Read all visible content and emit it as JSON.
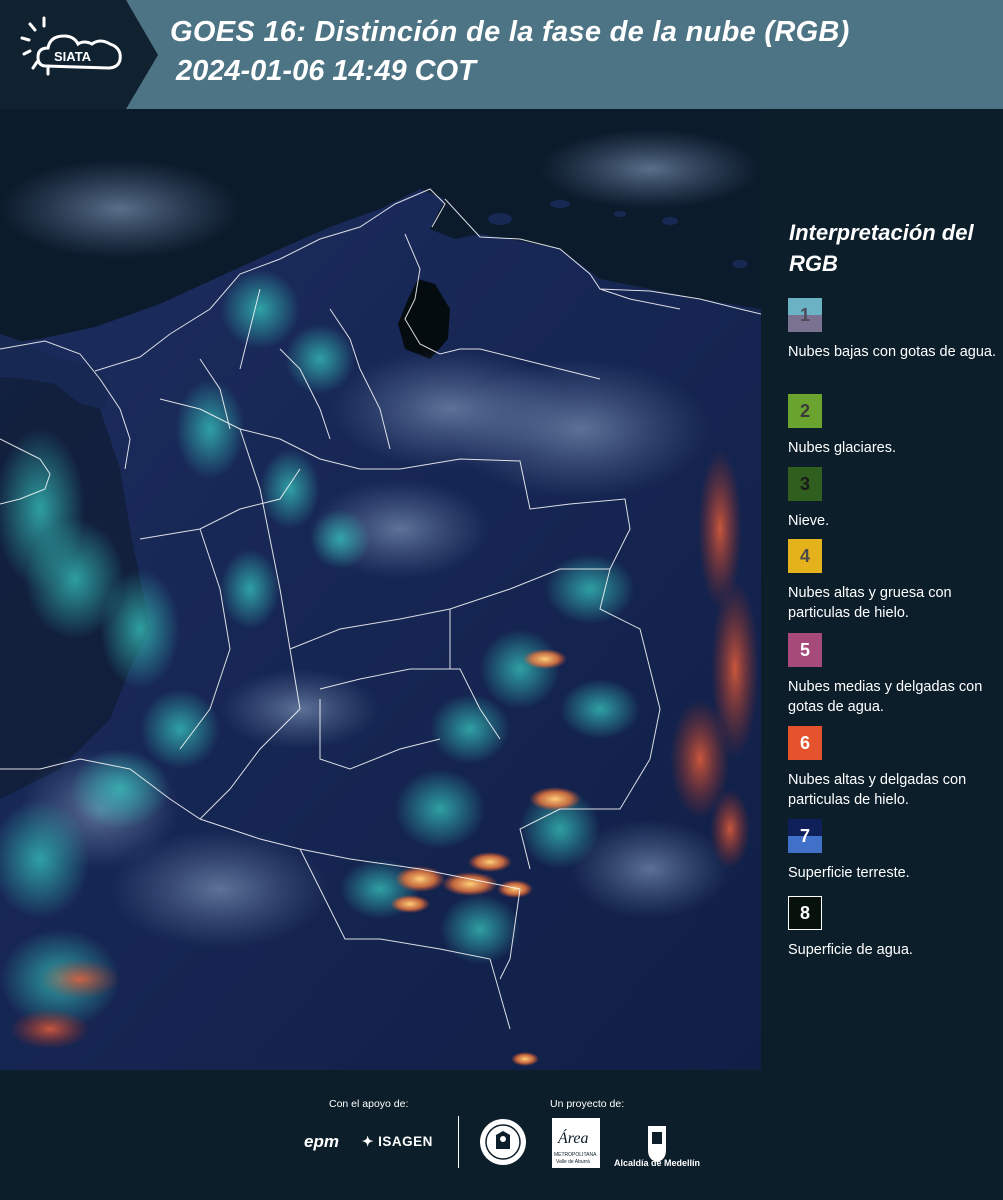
{
  "header": {
    "logo_text": "SIATA",
    "title": "GOES 16: Distinción de la fase de la nube (RGB)",
    "timestamp": "2024-01-06 14:49 COT"
  },
  "legend": {
    "title": "Interpretación del RGB",
    "items": [
      {
        "number": "1",
        "label": "Nubes bajas con gotas de agua.",
        "color_top": "#6bb3c4",
        "color_bottom": "#7a7290",
        "number_color": "#4a4a5a"
      },
      {
        "number": "2",
        "label": "Nubes glaciares.",
        "color_top": "#6aa32d",
        "color_bottom": "#6aa32d",
        "number_color": "#3a3a3a"
      },
      {
        "number": "3",
        "label": "Nieve.",
        "color_top": "#2f5e1f",
        "color_bottom": "#2f5e1f",
        "number_color": "#1a1a1a"
      },
      {
        "number": "4",
        "label": "Nubes altas y gruesa con particulas de hielo.",
        "color_top": "#e6b21c",
        "color_bottom": "#e6b21c",
        "number_color": "#4a4a4a"
      },
      {
        "number": "5",
        "label": "Nubes medias y delgadas con gotas de agua.",
        "color_top": "#a64a7a",
        "color_bottom": "#a64a7a",
        "number_color": "#ffffff"
      },
      {
        "number": "6",
        "label": "Nubes altas y delgadas con particulas de hielo.",
        "color_top": "#e4532c",
        "color_bottom": "#e4532c",
        "number_color": "#ffffff"
      },
      {
        "number": "7",
        "label": "Superficie terreste.",
        "color_top": "#0e1f5a",
        "color_bottom": "#4070c8",
        "number_color": "#ffffff"
      },
      {
        "number": "8",
        "label": "Superficie de agua.",
        "color_top": "#07120c",
        "color_bottom": "#07120c",
        "number_color": "#ffffff"
      }
    ]
  },
  "footer": {
    "support_label": "Con el apoyo de:",
    "project_label": "Un proyecto de:",
    "epm_text": "epm",
    "isagen_text": "ISAGEN",
    "area_text": "Área",
    "area_sub": "METROPOLITANA",
    "area_sub2": "Valle de Aburrá",
    "alcaldia_text": "Alcaldía de Medellín"
  }
}
